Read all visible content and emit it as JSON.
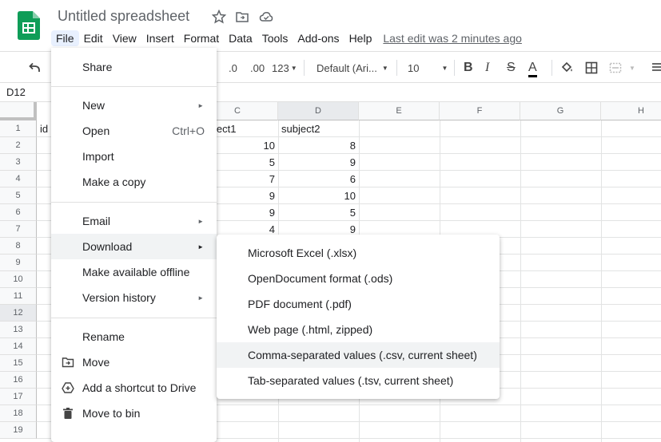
{
  "header": {
    "title": "Untitled spreadsheet",
    "last_edit": "Last edit was 2 minutes ago",
    "menus": [
      "File",
      "Edit",
      "View",
      "Insert",
      "Format",
      "Data",
      "Tools",
      "Add-ons",
      "Help"
    ]
  },
  "toolbar": {
    "decrease_decimal": ".0",
    "increase_decimal": ".00",
    "number_format": "123",
    "font": "Default (Ari...",
    "font_size": "10",
    "bold": "B",
    "italic": "I",
    "strikethrough": "S",
    "text_color": "A"
  },
  "namebox": {
    "cell": "D12"
  },
  "grid": {
    "columns": [
      "C",
      "D",
      "E",
      "F",
      "G",
      "H"
    ],
    "rows": [
      "1",
      "2",
      "3",
      "4",
      "5",
      "6",
      "7",
      "8",
      "9",
      "10",
      "11",
      "12",
      "13",
      "14",
      "15",
      "16",
      "17",
      "18",
      "19"
    ],
    "col_a_r1": "id",
    "c1": "ject1",
    "d1": "subject2",
    "c_values": [
      "10",
      "5",
      "7",
      "9",
      "9",
      "4"
    ],
    "d_values": [
      "8",
      "9",
      "6",
      "10",
      "5",
      "9"
    ]
  },
  "file_menu": {
    "share": "Share",
    "new": "New",
    "open": "Open",
    "open_shortcut": "Ctrl+O",
    "import": "Import",
    "make_copy": "Make a copy",
    "email": "Email",
    "download": "Download",
    "offline": "Make available offline",
    "version_history": "Version history",
    "rename": "Rename",
    "move": "Move",
    "add_shortcut": "Add a shortcut to Drive",
    "move_to_bin": "Move to bin"
  },
  "download_menu": {
    "xlsx": "Microsoft Excel (.xlsx)",
    "ods": "OpenDocument format (.ods)",
    "pdf": "PDF document (.pdf)",
    "html": "Web page (.html, zipped)",
    "csv": "Comma-separated values (.csv, current sheet)",
    "tsv": "Tab-separated values (.tsv, current sheet)"
  },
  "colors": {
    "sheets_green": "#0f9d58",
    "selected_bg": "#e8f0fe",
    "hover_bg": "#f1f3f4"
  }
}
